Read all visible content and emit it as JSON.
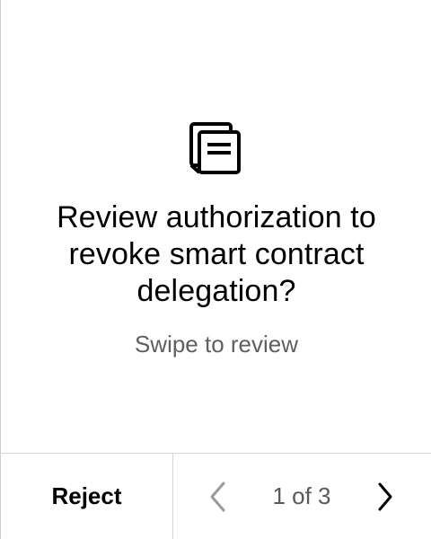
{
  "prompt": {
    "icon": "document-stack-icon",
    "title": "Review authorization to revoke smart contract delegation?",
    "subtitle": "Swipe to review"
  },
  "footer": {
    "reject_label": "Reject",
    "prev_icon": "chevron-left-icon",
    "next_icon": "chevron-right-icon",
    "page_indicator": "1 of 3",
    "current_page": 1,
    "total_pages": 3
  },
  "colors": {
    "background": "#ffffff",
    "text": "#000000",
    "muted_text": "#5f5f5f",
    "divider": "#d6d6d6",
    "disabled_chevron": "#9a9a9a"
  }
}
